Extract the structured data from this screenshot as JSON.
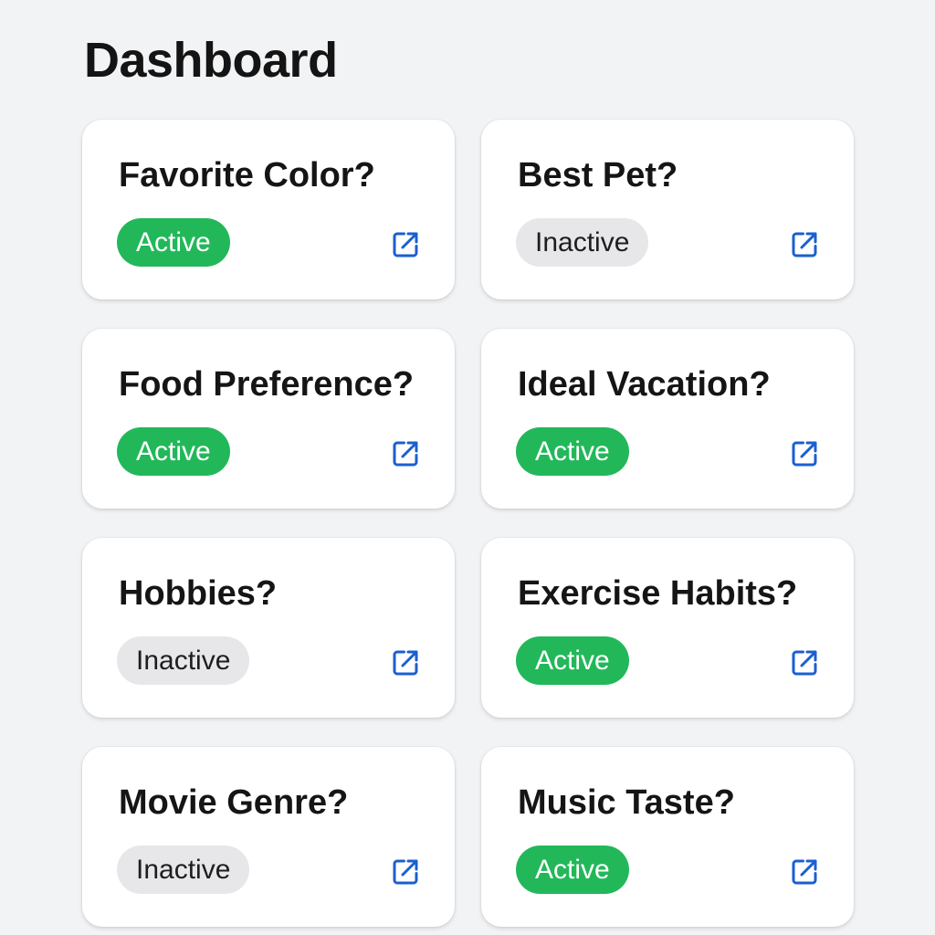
{
  "page": {
    "title": "Dashboard"
  },
  "colors": {
    "background": "#f2f3f5",
    "card": "#ffffff",
    "active_badge": "#22b85a",
    "inactive_badge": "#e7e7ea",
    "link_icon": "#1a5fd0"
  },
  "cards": [
    {
      "title": "Favorite Color?",
      "status": "Active",
      "icon": "external-link-icon"
    },
    {
      "title": "Best Pet?",
      "status": "Inactive",
      "icon": "external-link-icon"
    },
    {
      "title": "Food Preference?",
      "status": "Active",
      "icon": "external-link-icon"
    },
    {
      "title": "Ideal Vacation?",
      "status": "Active",
      "icon": "external-link-icon"
    },
    {
      "title": "Hobbies?",
      "status": "Inactive",
      "icon": "external-link-icon"
    },
    {
      "title": "Exercise Habits?",
      "status": "Active",
      "icon": "external-link-icon"
    },
    {
      "title": "Movie Genre?",
      "status": "Inactive",
      "icon": "external-link-icon"
    },
    {
      "title": "Music Taste?",
      "status": "Active",
      "icon": "external-link-icon"
    }
  ]
}
